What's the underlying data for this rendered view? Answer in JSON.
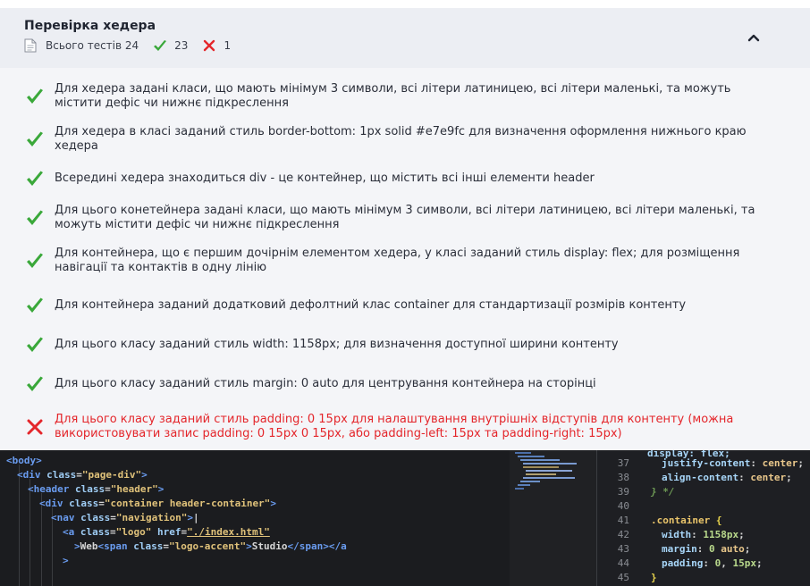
{
  "section": {
    "title": "Перевірка хедера",
    "total_label": "Всього тестів 24",
    "passed_count": "23",
    "failed_count": "1"
  },
  "colors": {
    "pass": "#3aa83a",
    "fail": "#e4262b",
    "panel_bg": "#f4f5f8",
    "header_bg": "#eceef3"
  },
  "tests": [
    {
      "status": "pass",
      "text": "Для хедера задані класи, що мають мінімум 3 символи, всі літери латиницею, всі літери маленькі, та можуть містити дефіс чи нижнє підкреслення"
    },
    {
      "status": "pass",
      "text": "Для хедера в класі заданий стиль border-bottom: 1px solid #e7e9fc для визначення оформлення нижнього краю хедера"
    },
    {
      "status": "pass",
      "text": "Всередині хедера знаходиться div - це контейнер, що містить всі інші елементи header"
    },
    {
      "status": "pass",
      "text": "Для цього конетейнера задані класи, що мають мінімум 3 символи, всі літери латиницею, всі літери маленькі, та можуть містити дефіс чи нижнє підкреслення"
    },
    {
      "status": "pass",
      "text": "Для контейнера, що є першим дочірнім елементом хедера, у класі заданий стиль display: flex; для розміщення навігації та контактів в одну лінію"
    },
    {
      "status": "pass",
      "text": "Для контейнера заданий додатковий дефолтний клас container для стандартизації розмірів контенту"
    },
    {
      "status": "pass",
      "text": "Для цього класу заданий стиль width: 1158px; для визначення доступної ширини контенту"
    },
    {
      "status": "pass",
      "text": "Для цього класу заданий стиль margin: 0 auto для центрування контейнера на сторінці"
    },
    {
      "status": "fail",
      "text": "Для цього класу заданий стиль padding: 0 15px для налаштування внутрішніх відступів для контенту (можна використовувати запис padding: 0 15px 0 15px, або padding-left: 15px та padding-right: 15px)"
    }
  ],
  "html_code": {
    "l1": {
      "t1": "<body>"
    },
    "l2": {
      "t1": "<div",
      "a1": "class",
      "eq": "=",
      "s1": "\"page-div\"",
      "t2": ">"
    },
    "l3": {
      "t1": "<header",
      "a1": "class",
      "eq": "=",
      "s1": "\"header\"",
      "t2": ">"
    },
    "l4": {
      "t1": "<div",
      "a1": "class",
      "eq": "=",
      "s1": "\"container header-container\"",
      "t2": ">"
    },
    "l5": {
      "t1": "<nav",
      "a1": "class",
      "eq": "=",
      "s1": "\"navigation\"",
      "t2": ">"
    },
    "l6": {
      "t1": "<a",
      "a1": "class",
      "eq": "=",
      "s1": "\"logo\"",
      "a2": "href",
      "eq2": "=",
      "s2": "\"./index.html\""
    },
    "l7": {
      "t1": ">",
      "p1": "Web",
      "t2": "<span",
      "a1": "class",
      "eq": "=",
      "s1": "\"logo-accent\"",
      "t3": ">",
      "p2": "Studio",
      "t4": "</span></a"
    },
    "l8": {
      "t1": ">"
    }
  },
  "css_code": {
    "l37": {
      "num": "37",
      "prop": "justify-content",
      "colon": ": ",
      "val": "center",
      "semi": ";"
    },
    "l38": {
      "num": "38",
      "prop": "align-content",
      "colon": ": ",
      "val": "center",
      "semi": ";"
    },
    "l39": {
      "num": "39",
      "text": "} */"
    },
    "l40": {
      "num": "40"
    },
    "l41": {
      "num": "41",
      "sel": ".container",
      "brace": " {"
    },
    "l42": {
      "num": "42",
      "prop": "width",
      "colon": ": ",
      "val": "1158px",
      "semi": ";"
    },
    "l43": {
      "num": "43",
      "prop": "margin",
      "colon": ": ",
      "val": "0",
      "val2": " auto",
      "semi": ";"
    },
    "l44": {
      "num": "44",
      "prop": "padding",
      "colon": ": ",
      "val": "0",
      "mid": ", ",
      "val2": "15px",
      "semi": ";"
    },
    "l45": {
      "num": "45",
      "brace": "}"
    }
  }
}
